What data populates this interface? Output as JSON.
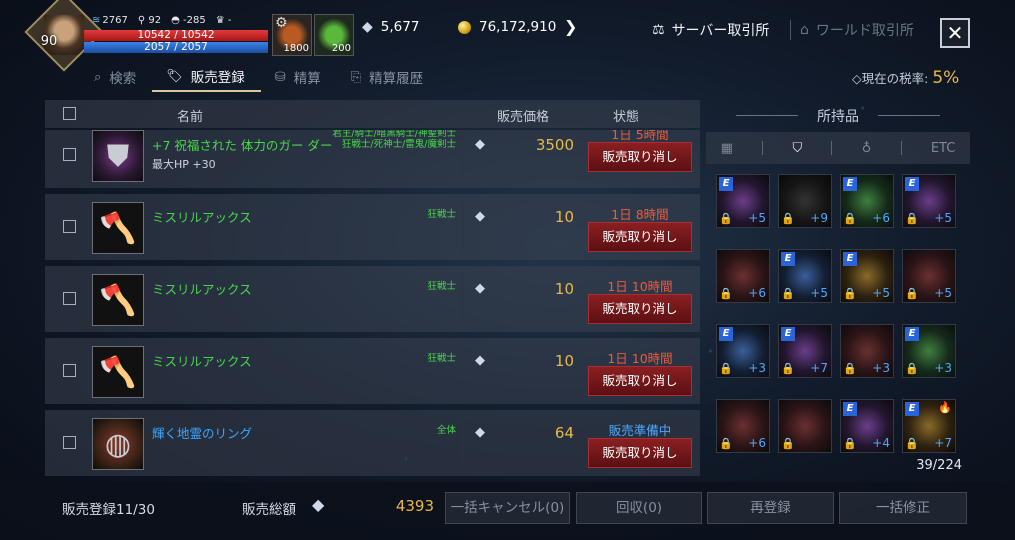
{
  "player": {
    "level": "90",
    "power": "2767",
    "stat2": "92",
    "stat3": "-285",
    "stat4": "-",
    "hp": "10542 / 10542",
    "mp": "2057 / 2057"
  },
  "potions": [
    {
      "count": "1800"
    },
    {
      "count": "200"
    }
  ],
  "currency": {
    "diamond": "5,677",
    "gold": "76,172,910"
  },
  "market_tabs": {
    "server": "サーバー取引所",
    "world": "ワールド取引所"
  },
  "tabs": [
    {
      "label": "検索",
      "icon": "search-icon"
    },
    {
      "label": "販売登録",
      "icon": "tag-icon"
    },
    {
      "label": "精算",
      "icon": "coins-icon"
    },
    {
      "label": "精算履歴",
      "icon": "history-icon"
    }
  ],
  "tax": {
    "label": "◇現在の税率:",
    "value": "5%"
  },
  "list_header": {
    "name": "名前",
    "price": "販売価格",
    "state": "状態"
  },
  "rows": [
    {
      "name": "+7 祝福された 体力のガー ダー",
      "sub": "最大HP +30",
      "classes": [
        "君主/騎士/暗黒騎士/神聖剣士",
        "狂戦士/死神士/雷鬼/魔剣士"
      ],
      "price": "3500",
      "state": "1日 5時間",
      "button": "販売取り消し",
      "rarity": "green"
    },
    {
      "name": "ミスリルアックス",
      "sub": "",
      "classes": [
        "狂戦士"
      ],
      "price": "10",
      "state": "1日 8時間",
      "button": "販売取り消し",
      "rarity": "green"
    },
    {
      "name": "ミスリルアックス",
      "sub": "",
      "classes": [
        "狂戦士"
      ],
      "price": "10",
      "state": "1日 10時間",
      "button": "販売取り消し",
      "rarity": "green"
    },
    {
      "name": "ミスリルアックス",
      "sub": "",
      "classes": [
        "狂戦士"
      ],
      "price": "10",
      "state": "1日 10時間",
      "button": "販売取り消し",
      "rarity": "green"
    },
    {
      "name": "輝く地霊のリング",
      "sub": "",
      "classes": [
        "全体"
      ],
      "price": "64",
      "state": "販売準備中",
      "button": "販売取り消し",
      "rarity": "blue"
    }
  ],
  "inventory": {
    "title": "所持品",
    "filters": [
      "grid-icon",
      "shield-icon",
      "potion-icon",
      "ETC"
    ],
    "count": "39/224",
    "slots": [
      {
        "e": true,
        "plus": "+5",
        "tone": "s-purple"
      },
      {
        "e": false,
        "plus": "+9",
        "tone": "s-dark"
      },
      {
        "e": true,
        "plus": "+6",
        "tone": "s-green"
      },
      {
        "e": true,
        "plus": "+5",
        "tone": "s-purple"
      },
      {
        "e": false,
        "plus": "+6",
        "tone": ""
      },
      {
        "e": true,
        "plus": "+5",
        "tone": "s-blue"
      },
      {
        "e": true,
        "plus": "+5",
        "tone": "s-gold"
      },
      {
        "e": false,
        "plus": "+5",
        "tone": ""
      },
      {
        "e": true,
        "plus": "+3",
        "tone": "s-blue"
      },
      {
        "e": true,
        "plus": "+7",
        "tone": "s-purple"
      },
      {
        "e": false,
        "plus": "+3",
        "tone": ""
      },
      {
        "e": true,
        "plus": "+3",
        "tone": "s-green"
      },
      {
        "e": false,
        "plus": "+6",
        "tone": ""
      },
      {
        "e": false,
        "plus": "",
        "tone": ""
      },
      {
        "e": true,
        "plus": "+4",
        "tone": "s-purple"
      },
      {
        "e": true,
        "plus": "+7",
        "tone": "s-gold",
        "flame": true
      }
    ]
  },
  "bottom": {
    "registered": "販売登録11/30",
    "total_label": "販売総額",
    "total_value": "4393",
    "buttons": [
      "一括キャンセル(0)",
      "回収(0)",
      "再登録",
      "一括修正"
    ]
  },
  "colors": {
    "price": "#e8b94a",
    "item_green": "#4ad64a",
    "item_blue": "#3ca6ff",
    "state_red": "#f05a3a",
    "cancel_button": "#8a1f22"
  }
}
